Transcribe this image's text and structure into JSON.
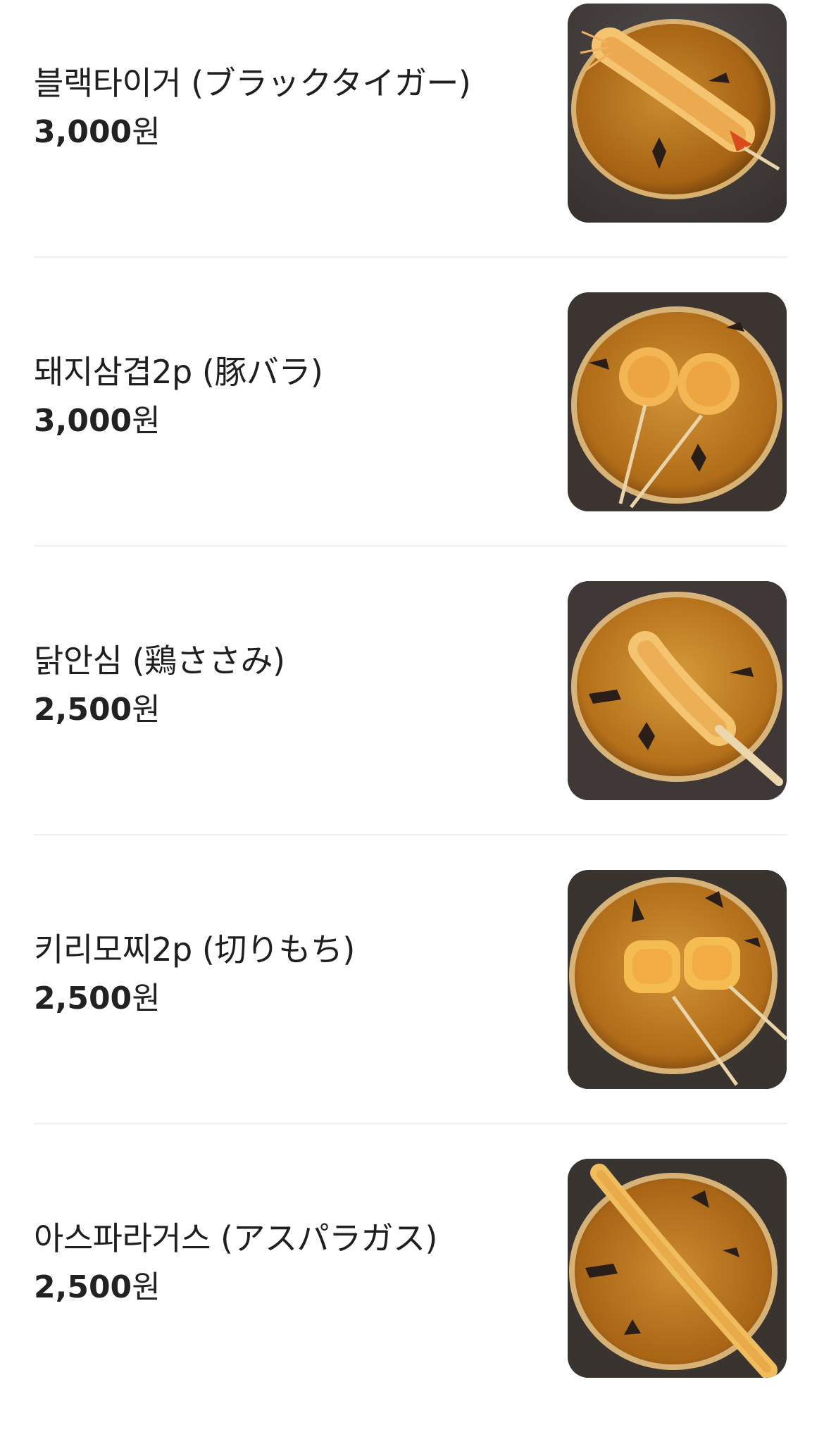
{
  "menu": {
    "items": [
      {
        "name": "블랙타이거 (ブラックタイガー)",
        "price_number": "3,000",
        "price_unit": "원",
        "photo": "shrimp-skewer-photo"
      },
      {
        "name": "돼지삼겹2p (豚バラ)",
        "price_number": "3,000",
        "price_unit": "원",
        "photo": "pork-belly-skewer-photo"
      },
      {
        "name": "닭안심 (鶏ささみ)",
        "price_number": "2,500",
        "price_unit": "원",
        "photo": "chicken-tender-skewer-photo"
      },
      {
        "name": "키리모찌2p (切りもち)",
        "price_number": "2,500",
        "price_unit": "원",
        "photo": "rice-cake-skewer-photo"
      },
      {
        "name": "아스파라거스 (アスパラガス)",
        "price_number": "2,500",
        "price_unit": "원",
        "photo": "asparagus-skewer-photo"
      }
    ]
  },
  "colors": {
    "plate": "#b8741f",
    "plate_rim": "#8a5414",
    "batter": "#e6a540",
    "table": "#3a3330",
    "divider": "#efefef"
  }
}
